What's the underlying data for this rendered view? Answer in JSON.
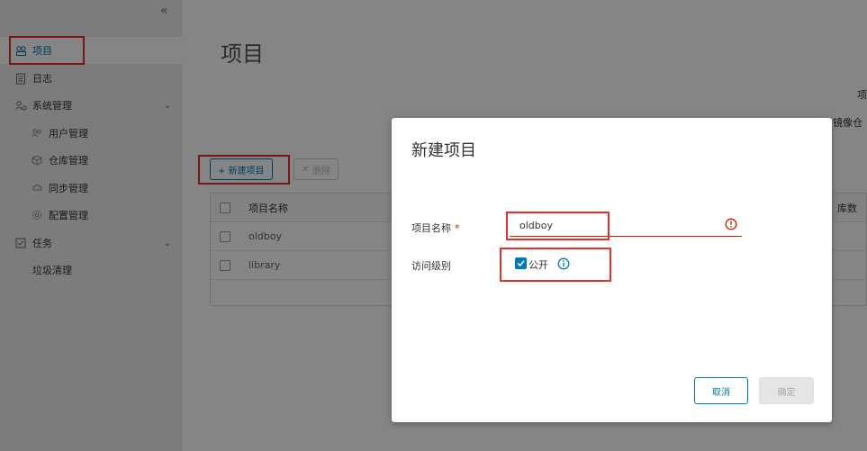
{
  "sidebar": {
    "collapse_glyph": "«",
    "items": [
      {
        "label": "项目",
        "icon": "projects-icon",
        "active": true
      },
      {
        "label": "日志",
        "icon": "logs-icon"
      },
      {
        "label": "系统管理",
        "icon": "admin-icon",
        "expandable": true
      },
      {
        "label": "用户管理",
        "icon": "users-icon",
        "sub": true
      },
      {
        "label": "仓库管理",
        "icon": "registry-icon",
        "sub": true
      },
      {
        "label": "同步管理",
        "icon": "replication-icon",
        "sub": true
      },
      {
        "label": "配置管理",
        "icon": "settings-icon",
        "sub": true
      },
      {
        "label": "任务",
        "icon": "tasks-icon",
        "expandable": true
      },
      {
        "label": "垃圾清理"
      }
    ]
  },
  "main": {
    "title": "项目",
    "new_project_button": "+ 新建项目",
    "delete_button": "删除",
    "table": {
      "header": "项目名称",
      "header_right": "库数",
      "rows": [
        "oldboy",
        "library"
      ]
    },
    "right_fragment_1": "项",
    "right_fragment_2": "镜像仓"
  },
  "modal": {
    "title": "新建项目",
    "name_label": "项目名称",
    "required_mark": "*",
    "name_value": "oldboy",
    "access_label": "访问级别",
    "public_label": "公开",
    "public_checked": true,
    "cancel_label": "取消",
    "ok_label": "确定"
  },
  "colors": {
    "accent": "#0079b8",
    "error": "#c92100",
    "annotation": "#e8302b"
  }
}
